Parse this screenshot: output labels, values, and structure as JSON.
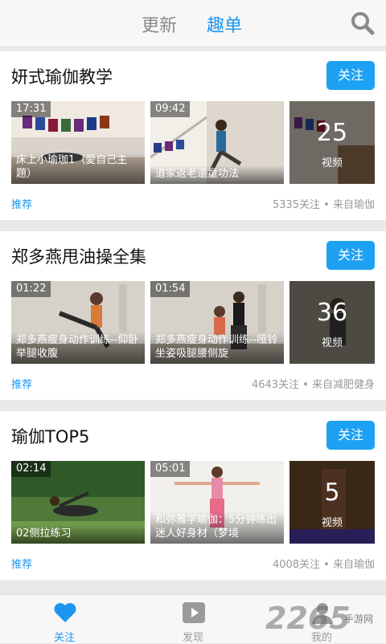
{
  "header": {
    "tab_update": "更新",
    "tab_list": "趣单"
  },
  "accent_color": "#1e96f0",
  "cards": [
    {
      "title": "妍式瑜伽教学",
      "follow_label": "关注",
      "videos": [
        {
          "duration": "17:31",
          "caption": "床上小瑜珈1（愛自己主題）"
        },
        {
          "duration": "09:42",
          "caption": "道家返老還童功法"
        }
      ],
      "count": "25",
      "count_unit": "视频",
      "recommend": "推荐",
      "meta": "5335关注 • 来自瑜伽"
    },
    {
      "title": "郑多燕甩油操全集",
      "follow_label": "关注",
      "videos": [
        {
          "duration": "01:22",
          "caption": "郑多燕瘦身动作训练--仰卧举腿收腹"
        },
        {
          "duration": "01:54",
          "caption": "郑多燕瘦身动作训练--哑铃坐姿吸腿腰侧旋"
        }
      ],
      "count": "36",
      "count_unit": "视频",
      "recommend": "推荐",
      "meta": "4643关注 • 来自减肥健身"
    },
    {
      "title": "瑜伽TOP5",
      "follow_label": "关注",
      "videos": [
        {
          "duration": "02:14",
          "caption": "02侧拉练习"
        },
        {
          "duration": "05:01",
          "caption": "和弥雅学瑜伽：5分钟练出迷人好身材（梦境"
        }
      ],
      "count": "5",
      "count_unit": "视频",
      "recommend": "推荐",
      "meta": "4008关注 • 来自瑜伽"
    }
  ],
  "bottom_nav": [
    {
      "label": "关注",
      "icon": "heart-icon"
    },
    {
      "label": "发现",
      "icon": "play-icon"
    },
    {
      "label": "我的",
      "icon": "user-icon"
    }
  ],
  "watermark": {
    "main": "2265",
    "sub": "手游网"
  }
}
